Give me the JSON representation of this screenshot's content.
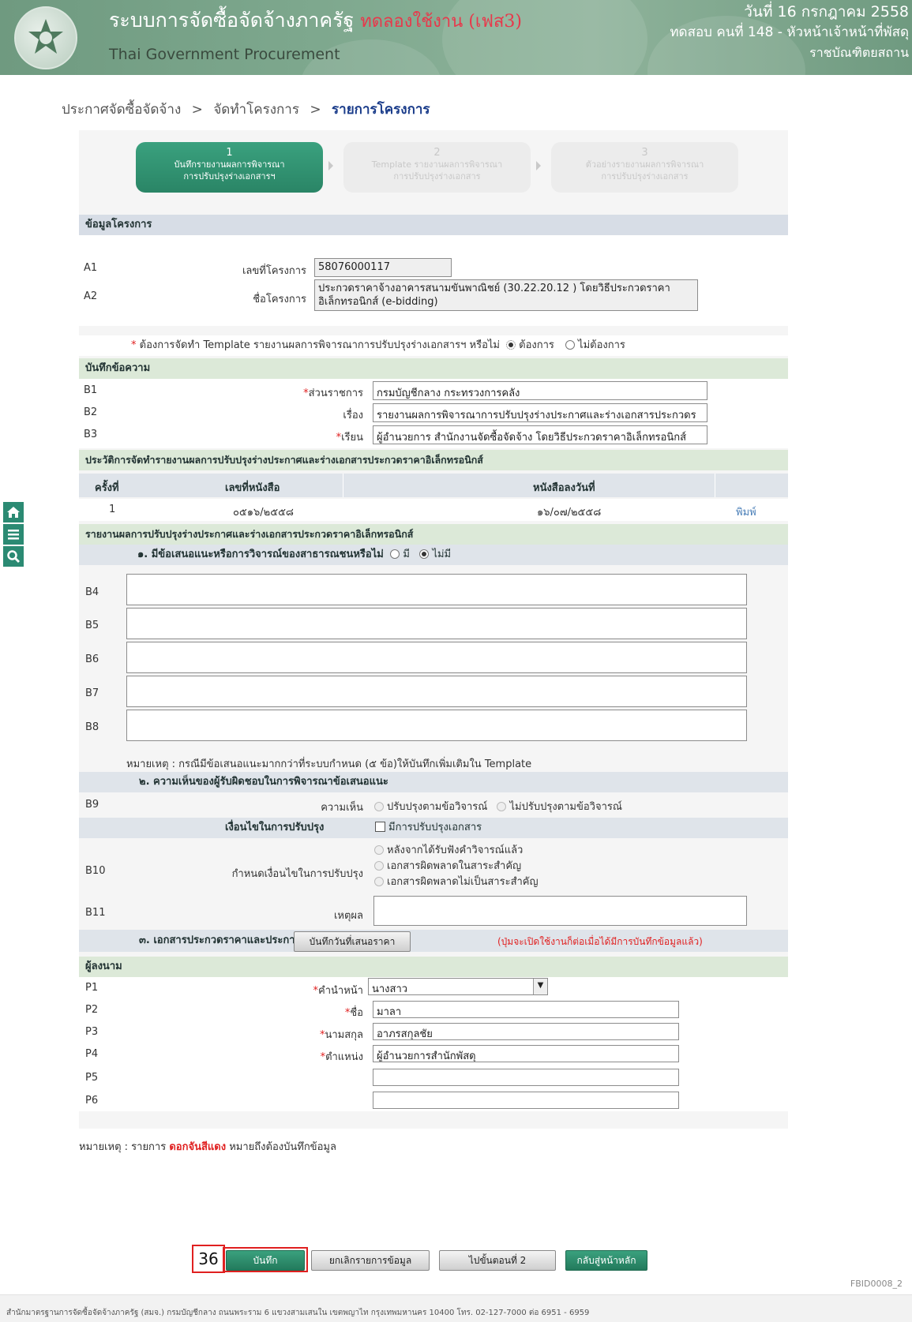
{
  "header": {
    "system_title": "ระบบการจัดซื้อจัดจ้างภาครัฐ",
    "test_label": "ทดลองใช้งาน (เฟส3)",
    "subtitle": "Thai Government Procurement",
    "date": "วันที่ 16 กรกฎาคม 2558",
    "user": "ทดสอบ คนที่ 148 - หัวหน้าเจ้าหน้าที่พัสดุ",
    "unit": "ราชบัณฑิตยสถาน"
  },
  "breadcrumb": {
    "items": [
      "ประกาศจัดซื้อจัดจ้าง",
      "จัดทำโครงการ",
      "รายการโครงการ"
    ],
    "separator": ">"
  },
  "steps": [
    {
      "num": "1",
      "line1": "บันทึกรายงานผลการพิจารณา",
      "line2": "การปรับปรุงร่างเอกสารฯ"
    },
    {
      "num": "2",
      "line1": "Template รายงานผลการพิจารณา",
      "line2": "การปรับปรุงร่างเอกสาร"
    },
    {
      "num": "3",
      "line1": "ตัวอย่างรายงานผลการพิจารณา",
      "line2": "การปรับปรุงร่างเอกสาร"
    }
  ],
  "project_info": {
    "section": "ข้อมูลโครงการ",
    "a1_code": "A1",
    "a1_label": "เลขที่โครงการ",
    "a1_value": "58076000117",
    "a2_code": "A2",
    "a2_label": "ชื่อโครงการ",
    "a2_line1": "ประกวดราคาจ้างอาคารสนามขันพาณิชย์ (30.22.20.12 ) โดยวิธีประกวดราคา",
    "a2_line2": "อิเล็กทรอนิกส์ (e-bidding)"
  },
  "template_question": {
    "text": "ต้องการจัดทำ Template รายงานผลการพิจารณาการปรับปรุงร่างเอกสารฯ หรือไม่",
    "yes": "ต้องการ",
    "no": "ไม่ต้องการ"
  },
  "memo": {
    "section": "บันทึกข้อความ",
    "b1_code": "B1",
    "b1_label": "ส่วนราชการ",
    "b1_value": "กรมบัญชีกลาง กระทรวงการคลัง",
    "b2_code": "B2",
    "b2_label": "เรื่อง",
    "b2_value": "รายงานผลการพิจารณาการปรับปรุงร่างประกาศและร่างเอกสารประกวดร",
    "b3_code": "B3",
    "b3_label": "เรียน",
    "b3_value": "ผู้อำนวยการ สำนักงานจัดซื้อจัดจ้าง โดยวิธีประกวดราคาอิเล็กทรอนิกส์"
  },
  "history": {
    "section": "ประวัติการจัดทำรายงานผลการปรับปรุงร่างประกาศและร่างเอกสารประกวดราคาอิเล็กทรอนิกส์",
    "columns": [
      "ครั้งที่",
      "เลขที่หนังสือ",
      "หนังสือลงวันที่"
    ],
    "rows": [
      {
        "no": "1",
        "doc_no": "๐๕๑๖/๒๕๕๘",
        "doc_date": "๑๖/๐๗/๒๕๕๘",
        "action": "พิมพ์"
      }
    ]
  },
  "report": {
    "section": "รายงานผลการปรับปรุงร่างประกาศและร่างเอกสารประกวดราคาอิเล็กทรอนิกส์",
    "q1": "๑. มีข้อเสนอแนะหรือการวิจารณ์ของสาธารณชนหรือไม่",
    "q1_yes": "มี",
    "q1_no": "ไม่มี",
    "b_codes": [
      "B4",
      "B5",
      "B6",
      "B7",
      "B8"
    ],
    "note": "หมายเหตุ : กรณีมีข้อเสนอแนะมากกว่าที่ระบบกำหนด (๕ ข้อ)ให้บันทึกเพิ่มเติมใน Template",
    "q2": "๒. ความเห็นของผู้รับผิดชอบในการพิจารณาข้อเสนอแนะ",
    "b9_code": "B9",
    "b9_label": "ความเห็น",
    "b9_opt1": "ปรับปรุงตามข้อวิจารณ์",
    "b9_opt2": "ไม่ปรับปรุงตามข้อวิจารณ์",
    "cond_title": "เงื่อนไขในการปรับปรุง",
    "cond_check": "มีการปรับปรุงเอกสาร",
    "b10_code": "B10",
    "b10_label": "กำหนดเงื่อนไขในการปรับปรุง",
    "b10_opt1": "หลังจากได้รับฟังคำวิจารณ์แล้ว",
    "b10_opt2": "เอกสารผิดพลาดในสาระสำคัญ",
    "b10_opt3": "เอกสารผิดพลาดไม่เป็นสาระสำคัญ",
    "b11_code": "B11",
    "b11_label": "เหตุผล",
    "q3": "๓. เอกสารประกวดราคาและประกาศเชิญชวน",
    "q3_button": "บันทึกวันที่เสนอราคา",
    "q3_hint": "(ปุ่มจะเปิดใช้งานก็ต่อเมื่อได้มีการบันทึกข้อมูลแล้ว)"
  },
  "signer": {
    "section": "ผู้ลงนาม",
    "p1_code": "P1",
    "p1_label": "คำนำหน้า",
    "p1_value": "นางสาว",
    "p2_code": "P2",
    "p2_label": "ชื่อ",
    "p2_value": "มาลา",
    "p3_code": "P3",
    "p3_label": "นามสกุล",
    "p3_value": "อาภรสกุลชัย",
    "p4_code": "P4",
    "p4_label": "ตำแหน่ง",
    "p4_value": "ผู้อำนวยการสำนักพัสดุ",
    "p5_code": "P5",
    "p6_code": "P6"
  },
  "legend": {
    "prefix": "หมายเหตุ : รายการ",
    "highlight": "ดอกจันสีแดง",
    "suffix": "หมายถึงต้องบันทึกข้อมูล"
  },
  "actions": {
    "save": "บันทึก",
    "cancel": "ยกเลิกรายการข้อมูล",
    "next": "ไปขั้นตอนที่ 2",
    "home": "กลับสู่หน้าหลัก"
  },
  "callout_number": "36",
  "footer": {
    "text": "สำนักมาตรฐานการจัดซื้อจัดจ้างภาครัฐ (สมจ.) กรมบัญชีกลาง ถนนพระราม 6 แขวงสามเสนใน เขตพญาไท กรุงเทพมหานคร 10400 โทร. 02-127-7000 ต่อ 6951 - 6959",
    "page_id": "FBID0008_2"
  },
  "colors": {
    "header_green": "#7ea88e",
    "accent_green": "#2a8566",
    "required_red": "#e02020",
    "section_blue": "#d7dde6",
    "section_green": "#dce9d8"
  }
}
